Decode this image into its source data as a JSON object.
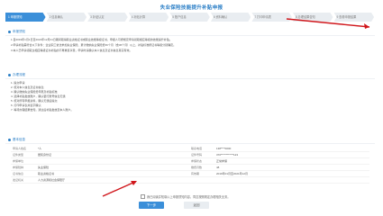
{
  "page": {
    "title": "失业保险技能提升补贴申报"
  },
  "steps": [
    {
      "label": "1 申报须知",
      "active": true
    },
    {
      "label": "2 信息确认",
      "active": false
    },
    {
      "label": "3 补贴认定",
      "active": false
    },
    {
      "label": "4 补贴计算",
      "active": false
    },
    {
      "label": "5 账户信息",
      "active": false
    },
    {
      "label": "6 资料确认",
      "active": false
    },
    {
      "label": "7 打印申请表",
      "active": false
    },
    {
      "label": "8 办理结果告知",
      "active": false
    },
    {
      "label": "9 查看申报结果",
      "active": false
    }
  ],
  "notice": {
    "heading": "申报须知",
    "lines": [
      "1.自2019年1月1日至2021年12月31日期间取得职业资格证书或职业技能等级证书，申报人可按规定申请领取相应等级的技能提升补贴。",
      "2.申请补贴需符合以下条件：企业职工依法参加失业保险、累计缴纳失业保险费36个月（含36个月）以上，补贴标准按证书等级分别确定。",
      "3.本人已申请领取过相应等级证书补贴的不再重复享受，申请时请确认本人信息及证书信息真实有效。"
    ]
  },
  "process": {
    "heading": "办理流程",
    "lines": [
      "1. 提交申请;",
      "2. 核对本人信息及证书信息;",
      "3. 确认缴纳失业保险费年限及补贴标准;",
      "4. 选择补贴发放账户，确认银行账号信息无误;",
      "5. 核对所有申报资料，确认无误后提交;",
      "6. 打印申请表并签字确认;",
      "7. 等待办理结果告知，通过后补贴发放至本人账户。"
    ]
  },
  "basic_info": {
    "heading": "基本信息",
    "rows": [
      {
        "label": "申请人姓名",
        "value": "*人",
        "label2": "联系电话",
        "value2": "138****0000"
      },
      {
        "label": "证件类型",
        "value": "居民身份证",
        "label2": "证件号码",
        "value2": "370************123"
      },
      {
        "label": "参保单位",
        "value": "",
        "label2": "参保状态",
        "value2": "正常参保"
      },
      {
        "label": "参保险种",
        "value": "失业保险",
        "label2": "缴费月数",
        "value2": "48"
      },
      {
        "label": "证书信息",
        "value": "职业资格证书",
        "label2": "有效期",
        "value2": "2019年01月至2021年12月"
      },
      {
        "label": "发证机关",
        "value": "人力资源和社会保障厅",
        "label2": "",
        "value2": ""
      }
    ]
  },
  "confirm": {
    "text": "我已阅读并知晓以上申报须知内容，同意按照规定办理相关业务。"
  },
  "buttons": {
    "next": "下一步",
    "back": "返回"
  }
}
